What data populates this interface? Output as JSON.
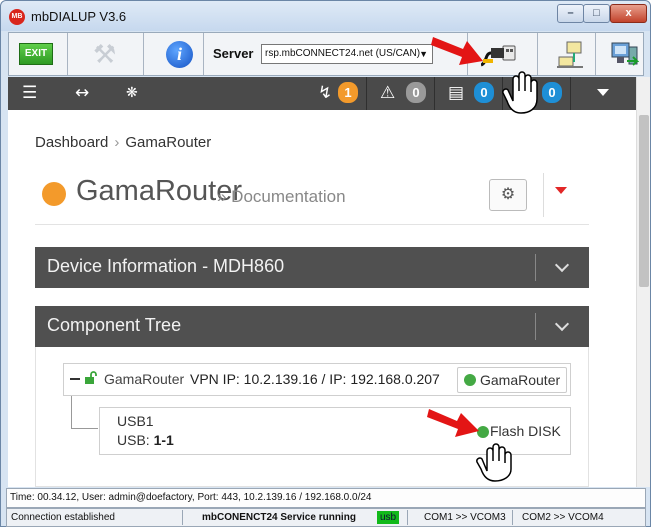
{
  "window": {
    "title": "mbDIALUP  V3.6",
    "app_icon_text": "MB",
    "controls": {
      "minimize": "–",
      "maximize": "□",
      "close": "x"
    }
  },
  "toolbar": {
    "exit_label": "EXIT",
    "server_label": "Server",
    "server_value": "rsp.mbCONNECT24.net (US/CAN)",
    "icons": [
      "exit-icon",
      "tools-icon",
      "info-icon",
      "usb-connect-icon",
      "network-icon",
      "computer-icon"
    ]
  },
  "nav": {
    "badges": {
      "alerts": "1",
      "warnings": "0",
      "devices": "0",
      "users": "0"
    },
    "colors": {
      "alerts": "#f39a2b",
      "warnings": "#9a9a9a",
      "devices": "#1e8fd6",
      "users": "#1e8fd6"
    }
  },
  "breadcrumb": {
    "root": "Dashboard",
    "separator": "›",
    "current": "GamaRouter"
  },
  "device": {
    "name": "GamaRouter",
    "subtitle": "» Documentation",
    "status_color": "#f39a2b"
  },
  "panels": {
    "device_info": "Device Information - MDH860",
    "component_tree": "Component Tree"
  },
  "tree": {
    "router_name": "GamaRouter",
    "router_ips": "VPN IP: 10.2.139.16 / IP: 192.168.0.207",
    "router_button": "GamaRouter",
    "usb_name": "USB1",
    "usb_port_label": "USB:",
    "usb_port_value": "1-1",
    "usb_device": "Flash DISK"
  },
  "status": {
    "line1": "Time: 00.34.12, User: admin@doefactory, Port: 443, 10.2.139.16 / 192.168.0.0/24",
    "connection": "Connection established",
    "service": "mbCONENCT24 Service running",
    "usb_tag": "usb",
    "com1": "COM1 >> VCOM3",
    "com2": "COM2 >> VCOM4"
  }
}
